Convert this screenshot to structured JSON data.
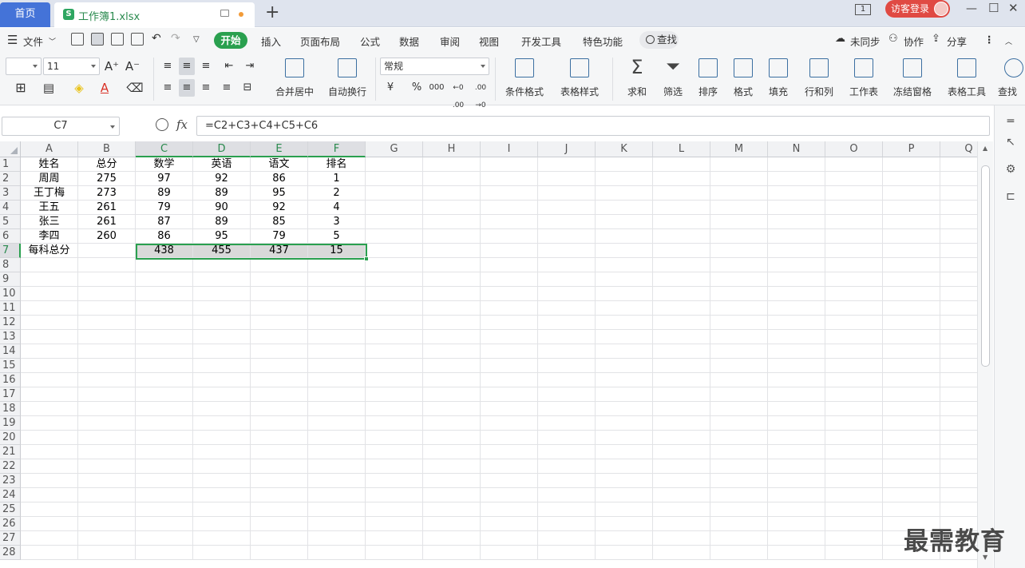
{
  "tabs": {
    "home": "首页",
    "doc": "工作簿1.xlsx",
    "window_count": "1"
  },
  "account": {
    "login": "访客登录"
  },
  "menu": {
    "file": "文件",
    "items": [
      "开始",
      "插入",
      "页面布局",
      "公式",
      "数据",
      "审阅",
      "视图",
      "开发工具",
      "特色功能"
    ],
    "search": "查找",
    "sync": "未同步",
    "collab": "协作",
    "share": "分享"
  },
  "toolbar": {
    "font_name": "",
    "font_size": "11",
    "number_format": "常规",
    "currency": "¥",
    "percent": "%",
    "thousands": "000",
    "inc_dec": "←0 .00",
    "dec_dec": ".00 →0",
    "merge": "合并居中",
    "wrap": "自动换行",
    "cond_format": "条件格式",
    "table_style": "表格样式",
    "sum": "求和",
    "filter": "筛选",
    "sort": "排序",
    "format": "格式",
    "fill": "填充",
    "rowcol": "行和列",
    "sheet": "工作表",
    "freeze": "冻结窗格",
    "table_tools": "表格工具",
    "find": "查找"
  },
  "formula": {
    "name_box": "C7",
    "fx": "fx",
    "content": "=C2+C3+C4+C5+C6"
  },
  "columns": [
    "A",
    "B",
    "C",
    "D",
    "E",
    "F",
    "G",
    "H",
    "I",
    "J",
    "K",
    "L",
    "M",
    "N",
    "O",
    "P",
    "Q"
  ],
  "row_numbers": [
    "1",
    "2",
    "3",
    "4",
    "5",
    "6",
    "7",
    "8",
    "9",
    "10",
    "11",
    "12",
    "13",
    "14",
    "15",
    "16",
    "17",
    "18",
    "19",
    "20",
    "21",
    "22",
    "23",
    "24",
    "25",
    "26",
    "27",
    "28"
  ],
  "rows": [
    [
      "姓名",
      "总分",
      "数学",
      "英语",
      "语文",
      "排名"
    ],
    [
      "周周",
      "275",
      "97",
      "92",
      "86",
      "1"
    ],
    [
      "王丁梅",
      "273",
      "89",
      "89",
      "95",
      "2"
    ],
    [
      "王五",
      "261",
      "79",
      "90",
      "92",
      "4"
    ],
    [
      "张三",
      "261",
      "87",
      "89",
      "85",
      "3"
    ],
    [
      "李四",
      "260",
      "86",
      "95",
      "79",
      "5"
    ],
    [
      "每科总分",
      "",
      "438",
      "455",
      "437",
      "15"
    ]
  ],
  "watermark": "最需教育"
}
